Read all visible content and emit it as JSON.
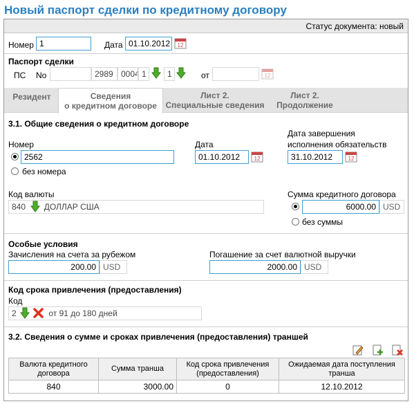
{
  "title": "Новый паспорт сделки по кредитному договору",
  "status": "Статус документа: новый",
  "header": {
    "number_label": "Номер",
    "number_value": "1",
    "date_label": "Дата",
    "date_value": "01.10.2012"
  },
  "passport": {
    "heading": "Паспорт сделки",
    "ps_label": "ПС",
    "no_label": "No",
    "part1": "",
    "part2": "2989",
    "part3": "0004",
    "part4": "1",
    "part5": "1",
    "from_label": "от",
    "from_value": ""
  },
  "tabs": [
    {
      "label": "Резидент"
    },
    {
      "label": "Сведения\nо кредитном договоре"
    },
    {
      "label": "Лист 2.\nСпециальные сведения"
    },
    {
      "label": "Лист 2.\nПродолжение"
    }
  ],
  "section1": {
    "heading": "3.1. Общие сведения о кредитном договоре",
    "number_label": "Номер",
    "number_value": "2562",
    "no_number_label": "без номера",
    "date_label": "Дата",
    "date_value": "01.10.2012",
    "end_label_1": "Дата завершения",
    "end_label_2": "исполнения обязательств",
    "end_value": "31.10.2012",
    "currency_label": "Код валюты",
    "currency_code": "840",
    "currency_name": "ДОЛЛАР США",
    "sum_label": "Сумма кредитного договора",
    "sum_value": "6000.00",
    "sum_currency": "USD",
    "no_sum_label": "без суммы"
  },
  "special": {
    "heading": "Особые условия",
    "credit_label": "Зачисления на счета за рубежом",
    "credit_value": "200.00",
    "credit_currency": "USD",
    "repay_label": "Погашение за счет валютной выручки",
    "repay_value": "2000.00",
    "repay_currency": "USD"
  },
  "term": {
    "heading": "Код срока привлечения (предоставления)",
    "code_label": "Код",
    "code_value": "2",
    "code_text": "от 91 до 180 дней"
  },
  "section2": {
    "heading": "3.2. Сведения о сумме и сроках привлечения (предоставления) траншей",
    "columns": [
      "Валюта кредитного договора",
      "Сумма транша",
      "Код срока привлечения (предоставления)",
      "Ожидаемая дата поступления транша"
    ],
    "rows": [
      [
        "840",
        "3000.00",
        "0",
        "12.10.2012"
      ]
    ]
  },
  "colors": {
    "title": "#2a7fc0",
    "input_border": "#3da0d0",
    "arrow_green": "#4cae2a",
    "delete_red": "#d9331f"
  }
}
